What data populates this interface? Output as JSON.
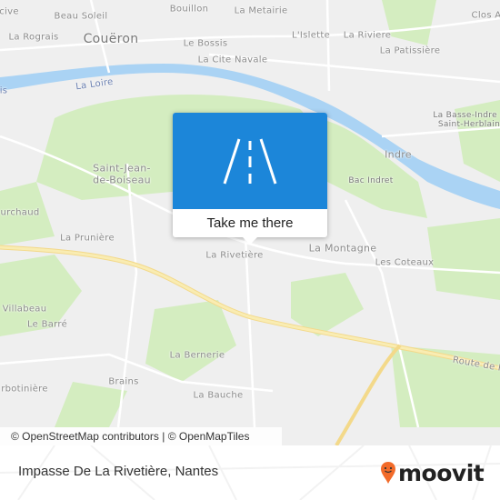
{
  "map": {
    "labels": {
      "cive": "cive",
      "beau_soleil": "Beau Soleil",
      "bouillon": "Bouillon",
      "la_metairie": "La Metairie",
      "clos": "Clos A",
      "la_rograis": "La Rograis",
      "coueron": "Couëron",
      "le_bossis": "Le Bossis",
      "lislette": "L'Islette",
      "la_riviere": "La Riviere",
      "la_patissiere": "La Patissière",
      "la_cite_navale": "La Cite Navale",
      "la_loire": "La Loire",
      "la_loire_2": "re",
      "is": "is",
      "basse_indre": "La Basse-Indre -",
      "saint_herblain": "Saint-Herblain",
      "indre": "Indre",
      "saint_jean": "Saint-Jean-",
      "de_boiseau": "de-Boiseau",
      "bac_indret": "Bac Indret",
      "urchaud": "urchaud",
      "la_pruniere": "La Prunière",
      "la_rivetiere": "La Rivetière",
      "la_montagne": "La Montagne",
      "les_coteaux": "Les Coteaux",
      "villabeau": "Villabeau",
      "le_barre": "Le Barré",
      "la_bernerie": "La Bernerie",
      "route": "Route de P",
      "brains": "Brains",
      "la_bauche": "La Bauche",
      "rbotiniere": "rbotinière"
    },
    "colors": {
      "land": "#efefef",
      "water": "#aad3f4",
      "green": "#d4edc0",
      "motorway": "#f9e9a6",
      "accent": "#1c86d9"
    }
  },
  "popup": {
    "icon": "road-icon",
    "label": "Take me there"
  },
  "attribution": "© OpenStreetMap contributors | © OpenMapTiles",
  "footer": {
    "address": "Impasse De La Rivetière, Nantes",
    "brand": "moovit",
    "brand_color": "#f26b2a"
  }
}
